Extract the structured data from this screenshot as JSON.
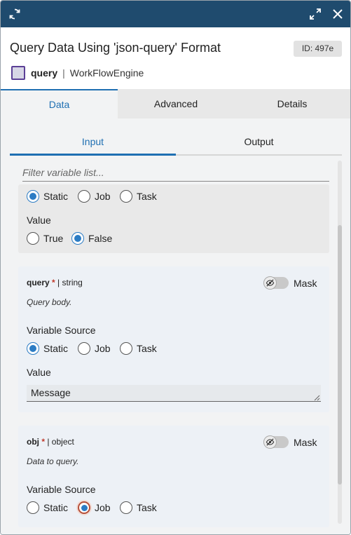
{
  "window": {
    "icons": [
      "refresh-icon",
      "expand-icon",
      "close-icon"
    ],
    "colors": {
      "topbar": "#1f4b6e",
      "accent": "#1f6fb2",
      "required": "#c0392b"
    }
  },
  "header": {
    "title": "Query Data Using 'json-query' Format",
    "id_badge": "ID: 497e",
    "node_name": "query",
    "separator": "|",
    "engine": "WorkFlowEngine"
  },
  "main_tabs": [
    {
      "label": "Data",
      "active": true
    },
    {
      "label": "Advanced",
      "active": false
    },
    {
      "label": "Details",
      "active": false
    }
  ],
  "sub_tabs": [
    {
      "label": "Input",
      "active": true
    },
    {
      "label": "Output",
      "active": false
    }
  ],
  "filter": {
    "placeholder": "Filter variable list..."
  },
  "cards": [
    {
      "source_options": [
        "Static",
        "Job",
        "Task"
      ],
      "source_selected": "Static",
      "value_label": "Value",
      "value_options": [
        "True",
        "False"
      ],
      "value_selected": "False"
    },
    {
      "name": "query",
      "required_mark": "*",
      "type": "| string",
      "description": "Query body.",
      "mask_label": "Mask",
      "mask_on": false,
      "source_label": "Variable Source",
      "source_options": [
        "Static",
        "Job",
        "Task"
      ],
      "source_selected": "Static",
      "value_label": "Value",
      "value": "Message"
    },
    {
      "name": "obj",
      "required_mark": "*",
      "type": "| object",
      "description": "Data to query.",
      "mask_label": "Mask",
      "mask_on": false,
      "source_label": "Variable Source",
      "source_options": [
        "Static",
        "Job",
        "Task"
      ],
      "source_selected": "Job"
    }
  ]
}
